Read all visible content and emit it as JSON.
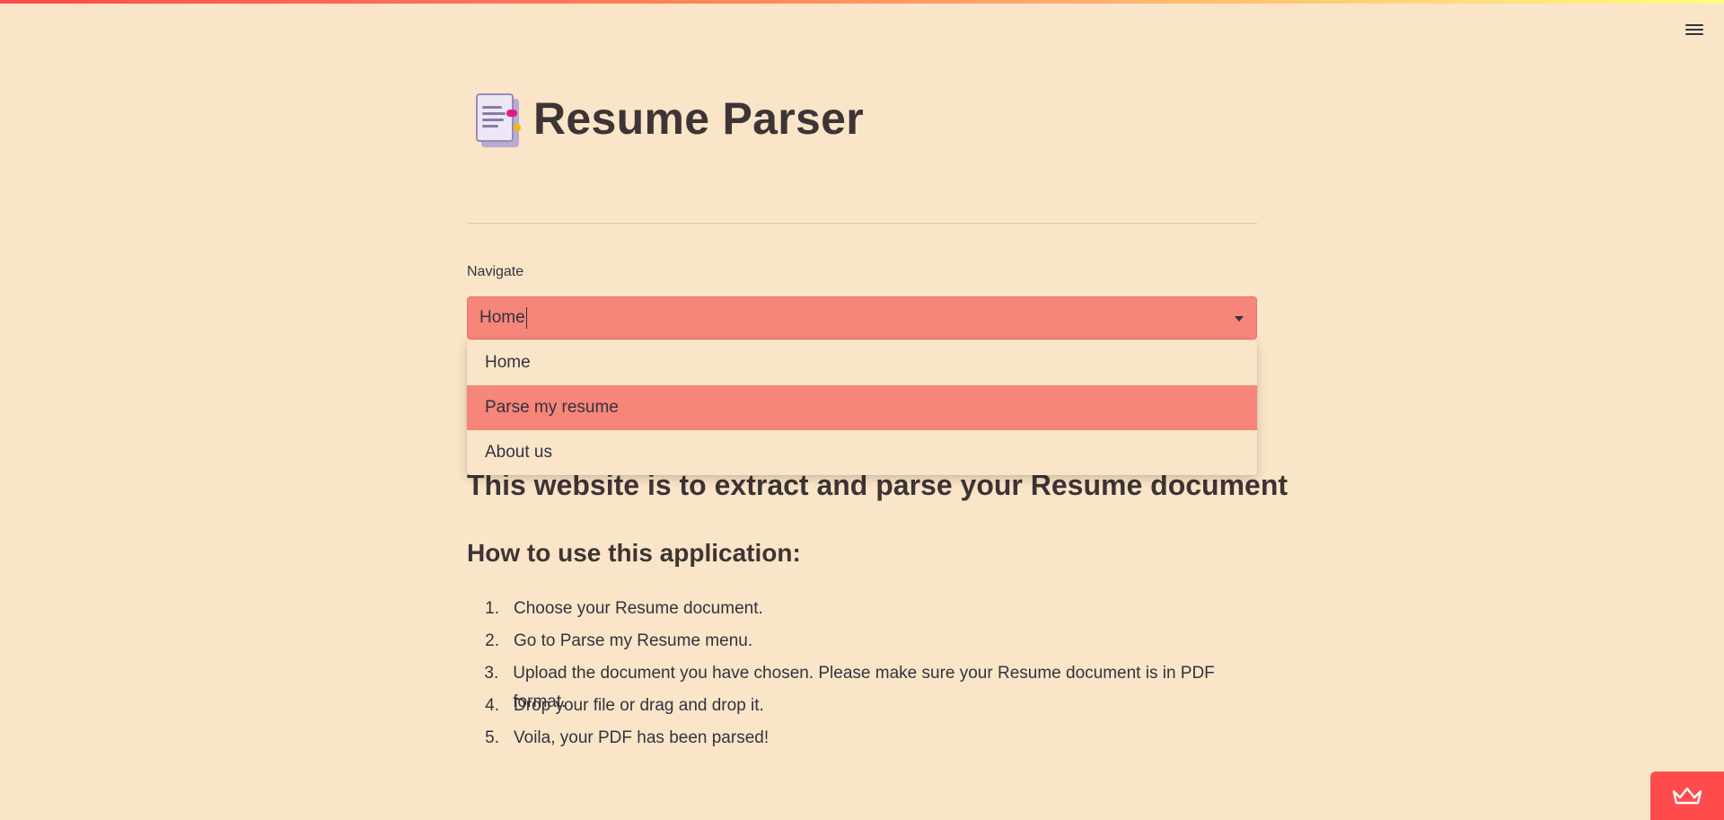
{
  "header": {
    "menu_icon": "hamburger-menu-icon"
  },
  "title": {
    "icon": "document-icon",
    "text": "Resume Parser"
  },
  "navigate": {
    "label": "Navigate",
    "selected": "Home",
    "options": [
      "Home",
      "Parse my resume",
      "About us"
    ],
    "highlighted_option": "Parse my resume"
  },
  "content": {
    "headline": "This website is to extract and parse your Resume document",
    "subheading": "How to use this application:",
    "steps": [
      {
        "num": "1.",
        "text": "Choose your Resume document."
      },
      {
        "num": "2.",
        "text": "Go to Parse my Resume menu."
      },
      {
        "num": "3.",
        "text": "Upload the document you have chosen. Please make sure your Resume document is in PDF format."
      },
      {
        "num": "4.",
        "text": "Drop your file or drag and drop it."
      },
      {
        "num": "5.",
        "text": "Voila, your PDF has been parsed!"
      }
    ]
  },
  "badge": {
    "icon": "crown-icon"
  },
  "colors": {
    "background": "#fbe5c8",
    "accent": "#f6857a",
    "badge": "#ff4b4b",
    "text": "#31333f"
  }
}
